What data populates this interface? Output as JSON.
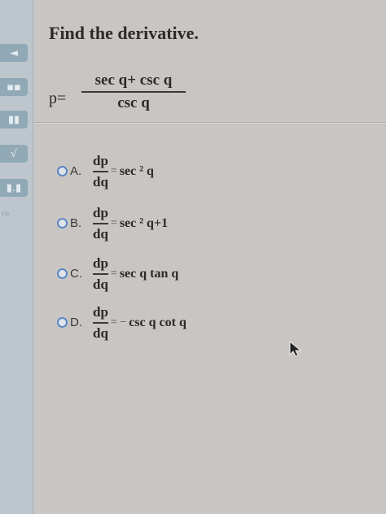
{
  "sidebar": {
    "buttons": [
      "◄",
      "▪▪",
      "▮▮",
      "√",
      "▮.▮"
    ],
    "partial_text": "re"
  },
  "question": {
    "title": "Find the derivative.",
    "lhs": "p=",
    "numerator": "sec q+ csc q",
    "denominator": "csc q"
  },
  "choices": [
    {
      "letter": "A.",
      "num": "dp",
      "den": "dq",
      "eq": "=",
      "expr": "sec ² q"
    },
    {
      "letter": "B.",
      "num": "dp",
      "den": "dq",
      "eq": "=",
      "expr": "sec ² q+1"
    },
    {
      "letter": "C.",
      "num": "dp",
      "den": "dq",
      "eq": "=",
      "expr": "sec q tan q"
    },
    {
      "letter": "D.",
      "num": "dp",
      "den": "dq",
      "eq": "= −",
      "expr": "csc q cot q"
    }
  ],
  "colors": {
    "radio_border": "#5d88c4",
    "sidebar_button": "#8aa4b4"
  },
  "icons": {
    "cursor": "arrow-cursor-icon"
  }
}
